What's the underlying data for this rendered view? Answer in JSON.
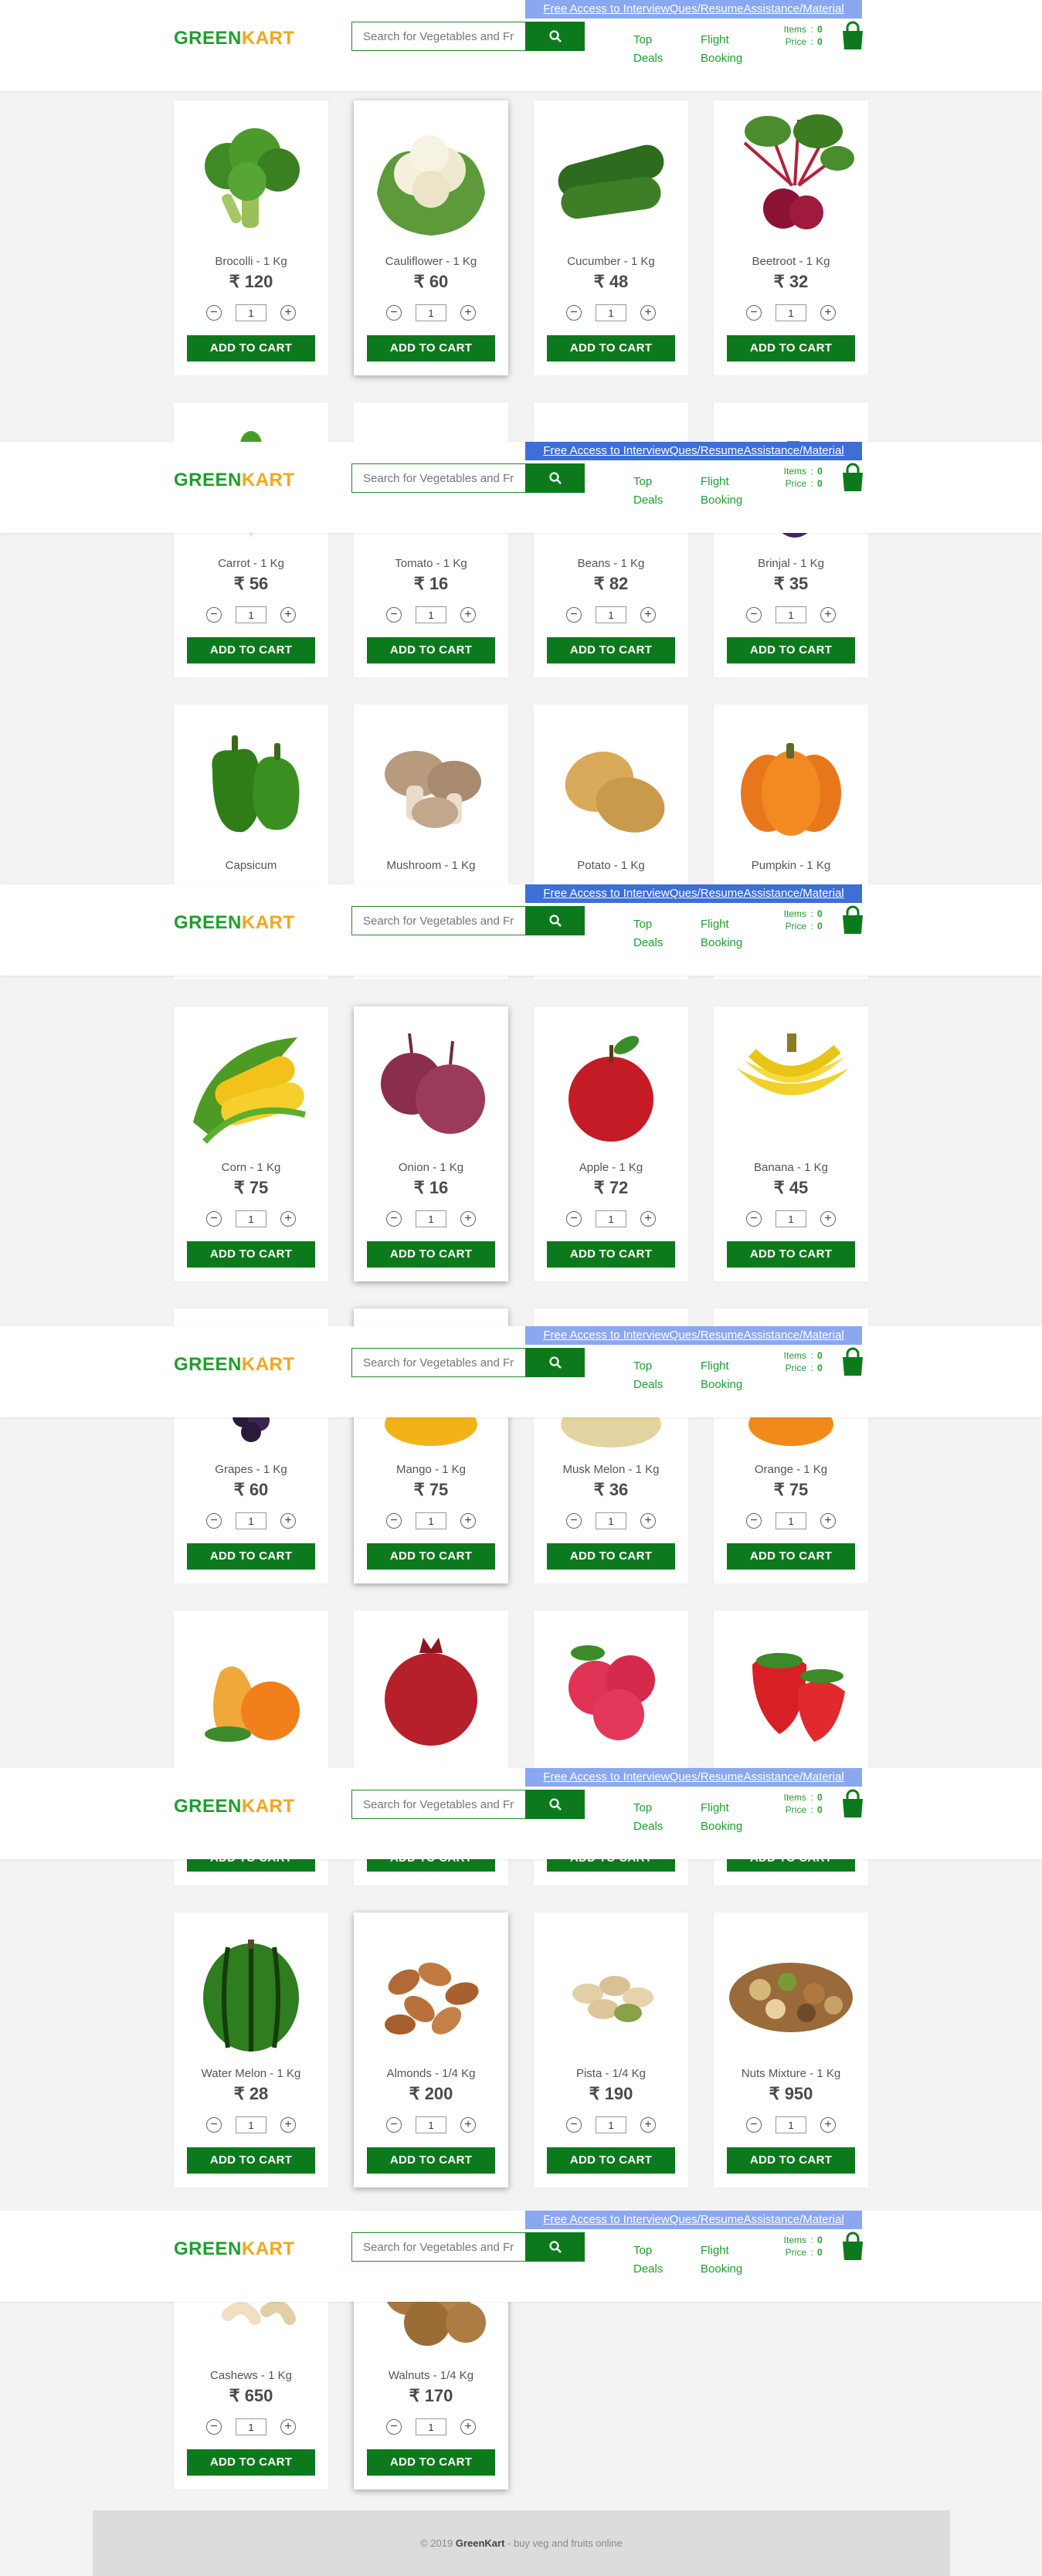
{
  "header": {
    "promo": "Free Access to InterviewQues/ResumeAssistance/Material",
    "logo_green": "GREEN",
    "logo_orange": "KART",
    "search_placeholder": "Search for Vegetables and Fruits",
    "links": [
      {
        "line1": "Top",
        "line2": "Deals"
      },
      {
        "line1": "Flight",
        "line2": "Booking"
      }
    ],
    "items_label": "Items",
    "price_label": "Price",
    "colon": ":",
    "items_value": "0",
    "price_value": "0",
    "promo_colors": [
      "#8aa8ef",
      "#3d6fd6",
      "#3d6fd6",
      "#8aa8ef",
      "#8aa8ef",
      "#8aa8ef",
      "#3d6fd6"
    ]
  },
  "quantity_default": "1",
  "add_label": "ADD TO CART",
  "products": [
    {
      "name": "Brocolli - 1 Kg",
      "price": "₹ 120",
      "icon": "broccoli-icon"
    },
    {
      "name": "Cauliflower - 1 Kg",
      "price": "₹ 60",
      "icon": "cauliflower-icon"
    },
    {
      "name": "Cucumber - 1 Kg",
      "price": "₹ 48",
      "icon": "cucumber-icon"
    },
    {
      "name": "Beetroot - 1 Kg",
      "price": "₹ 32",
      "icon": "beetroot-icon"
    },
    {
      "name": "Carrot - 1 Kg",
      "price": "₹ 56",
      "icon": "carrot-icon"
    },
    {
      "name": "Tomato - 1 Kg",
      "price": "₹ 16",
      "icon": "tomato-icon"
    },
    {
      "name": "Beans - 1 Kg",
      "price": "₹ 82",
      "icon": "beans-icon"
    },
    {
      "name": "Brinjal - 1 Kg",
      "price": "₹ 35",
      "icon": "brinjal-icon"
    },
    {
      "name": "Capsicum",
      "price": "",
      "icon": "capsicum-icon"
    },
    {
      "name": "Mushroom - 1 Kg",
      "price": "",
      "icon": "mushroom-icon"
    },
    {
      "name": "Potato - 1 Kg",
      "price": "",
      "icon": "potato-icon"
    },
    {
      "name": "Pumpkin - 1 Kg",
      "price": "",
      "icon": "pumpkin-icon"
    },
    {
      "name": "Corn - 1 Kg",
      "price": "₹ 75",
      "icon": "corn-icon"
    },
    {
      "name": "Onion - 1 Kg",
      "price": "₹ 16",
      "icon": "onion-icon"
    },
    {
      "name": "Apple - 1 Kg",
      "price": "₹ 72",
      "icon": "apple-icon"
    },
    {
      "name": "Banana - 1 Kg",
      "price": "₹ 45",
      "icon": "banana-icon"
    },
    {
      "name": "Grapes - 1 Kg",
      "price": "₹ 60",
      "icon": "grapes-icon"
    },
    {
      "name": "Mango - 1 Kg",
      "price": "₹ 75",
      "icon": "mango-icon"
    },
    {
      "name": "Musk Melon - 1 Kg",
      "price": "₹ 36",
      "icon": "muskmelon-icon"
    },
    {
      "name": "Orange - 1 Kg",
      "price": "₹ 75",
      "icon": "orange-icon"
    },
    {
      "name": "",
      "price": "",
      "icon": "pears-icon"
    },
    {
      "name": "",
      "price": "",
      "icon": "pomegranate-icon"
    },
    {
      "name": "",
      "price": "",
      "icon": "raspberry-icon"
    },
    {
      "name": "",
      "price": "",
      "icon": "strawberry-icon"
    },
    {
      "name": "Water Melon - 1 Kg",
      "price": "₹ 28",
      "icon": "watermelon-icon"
    },
    {
      "name": "Almonds - 1/4 Kg",
      "price": "₹ 200",
      "icon": "almonds-icon"
    },
    {
      "name": "Pista - 1/4 Kg",
      "price": "₹ 190",
      "icon": "pista-icon"
    },
    {
      "name": "Nuts Mixture - 1 Kg",
      "price": "₹ 950",
      "icon": "nuts-mixture-icon"
    },
    {
      "name": "Cashews - 1 Kg",
      "price": "₹ 650",
      "icon": "cashews-icon"
    },
    {
      "name": "Walnuts - 1/4 Kg",
      "price": "₹ 170",
      "icon": "walnuts-icon"
    }
  ],
  "footer": {
    "prefix": "© 2019",
    "brand": "GreenKart",
    "suffix": "- buy veg and fruits online"
  },
  "colors": {
    "accent": "#0c7a1c",
    "logo_green": "#1f9e2e",
    "logo_orange": "#f2a71b"
  }
}
